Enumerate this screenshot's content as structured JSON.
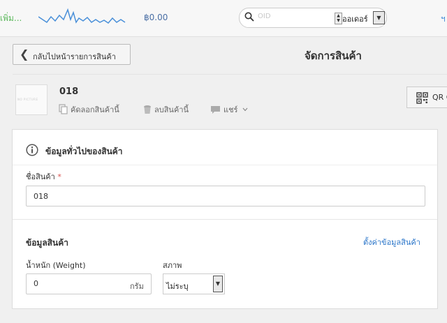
{
  "topbar": {
    "add_label": "เพิ่ม...",
    "balance": "฿0.00",
    "right_mark": "ฯ",
    "search": {
      "placeholder": "OID",
      "type_value": "ออเดอร์",
      "spin_up": "▲",
      "spin_down": "▼",
      "dropdown_arrow": "▼"
    },
    "sparkline_color": "#4a90d9"
  },
  "header": {
    "back_label": "กลับไปหน้ารายการสินค้า",
    "back_icon": "❮",
    "page_title": "จัดการสินค้า"
  },
  "product": {
    "thumbnail_text": "NO PICTURE",
    "name": "018",
    "actions": {
      "copy": "คัดลอกสินค้านี้",
      "delete": "ลบสินค้านี้",
      "share": "แชร์"
    },
    "qr_label": "QR C"
  },
  "general_section": {
    "title": "ข้อมูลทั่วไปของสินค้า",
    "name_label": "ชื่อสินค้า",
    "required_mark": "*",
    "name_value": "018"
  },
  "info_section": {
    "title": "ข้อมูลสินค้า",
    "settings_link": "ตั้งค่าข้อมูลสินค้า",
    "weight_label": "น้ำหนัก (Weight)",
    "weight_value": "0",
    "weight_unit": "กรัม",
    "condition_label": "สภาพ",
    "condition_value": "ไม่ระบุ",
    "condition_arrow": "▼"
  },
  "colors": {
    "link": "#2a75c9",
    "required": "#d9534f",
    "add_green": "#5cb85c"
  }
}
